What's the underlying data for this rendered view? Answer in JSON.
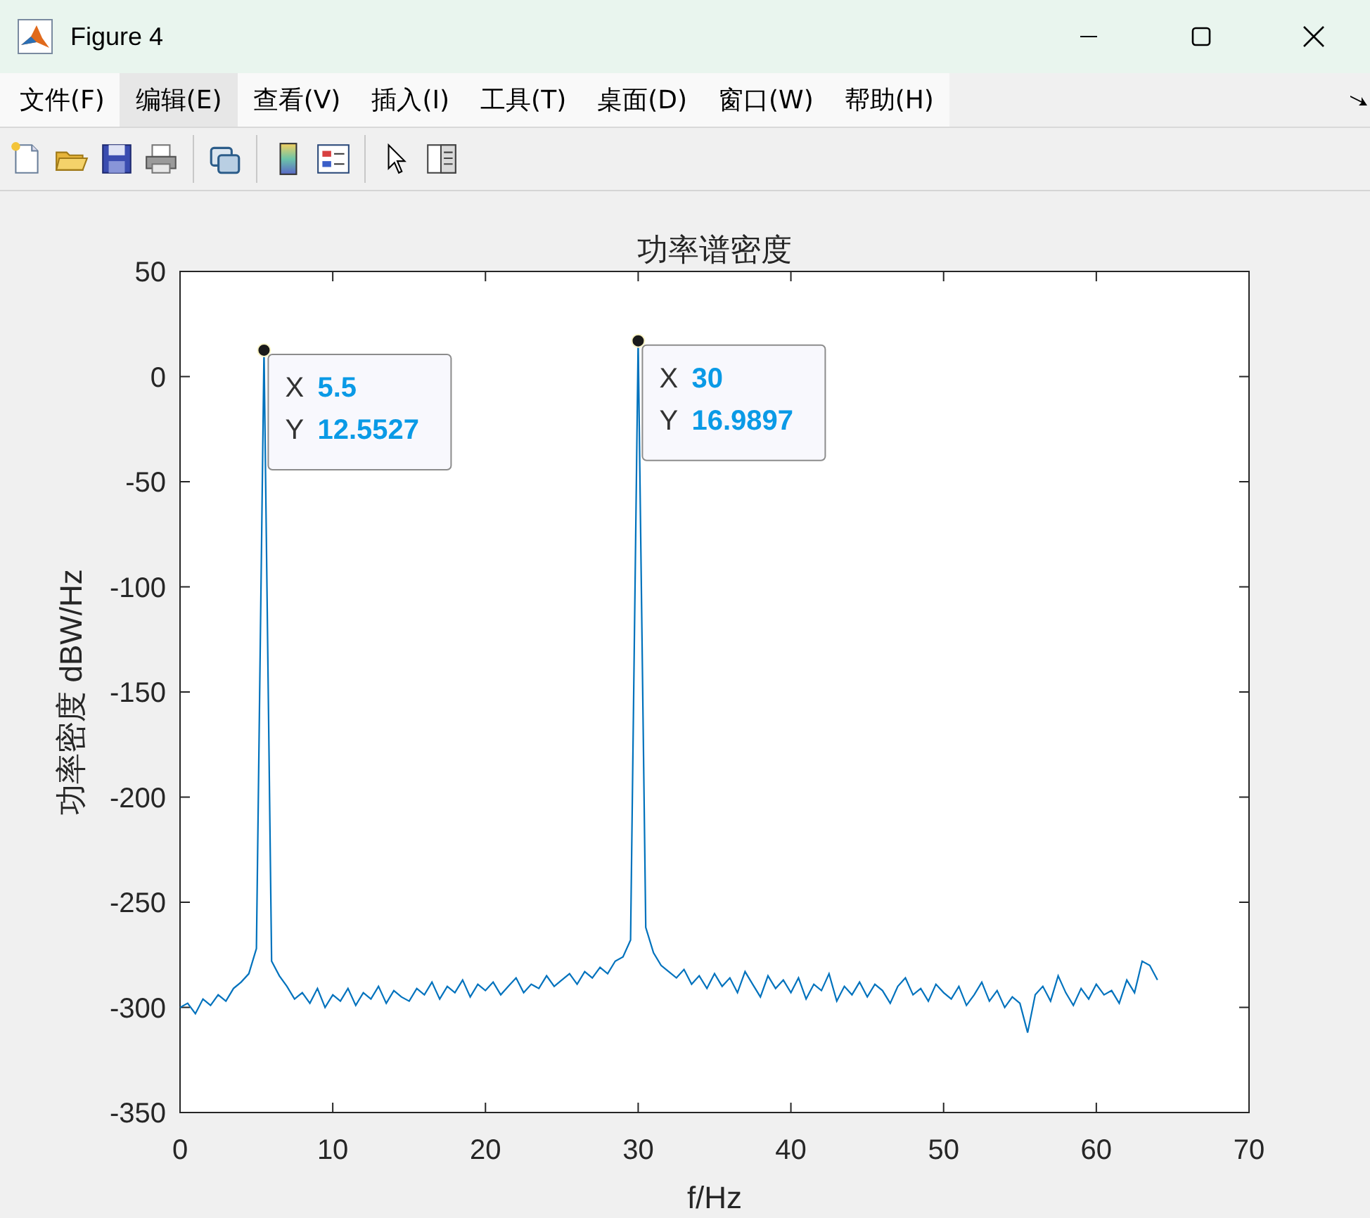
{
  "window": {
    "title": "Figure 4"
  },
  "menu": [
    {
      "label": "文件(F)",
      "selected": false
    },
    {
      "label": "编辑(E)",
      "selected": true
    },
    {
      "label": "查看(V)",
      "selected": false
    },
    {
      "label": "插入(I)",
      "selected": false
    },
    {
      "label": "工具(T)",
      "selected": false
    },
    {
      "label": "桌面(D)",
      "selected": false
    },
    {
      "label": "窗口(W)",
      "selected": false
    },
    {
      "label": "帮助(H)",
      "selected": false
    }
  ],
  "toolbar": [
    {
      "kind": "new"
    },
    {
      "kind": "open"
    },
    {
      "kind": "save"
    },
    {
      "kind": "print"
    },
    {
      "kind": "separator"
    },
    {
      "kind": "link"
    },
    {
      "kind": "separator"
    },
    {
      "kind": "colorbar"
    },
    {
      "kind": "legend"
    },
    {
      "kind": "separator"
    },
    {
      "kind": "pointer"
    },
    {
      "kind": "inspector"
    }
  ],
  "plot": {
    "chart_data": {
      "type": "line",
      "title": "功率谱密度",
      "xlabel": "f/Hz",
      "ylabel": "功率密度 dBW/Hz",
      "xlim": [
        0,
        70
      ],
      "ylim": [
        -350,
        50
      ],
      "xticks": [
        0,
        10,
        20,
        30,
        40,
        50,
        60,
        70
      ],
      "yticks": [
        -350,
        -300,
        -250,
        -200,
        -150,
        -100,
        -50,
        0,
        50
      ],
      "x": [
        0,
        0.5,
        1,
        1.5,
        2,
        2.5,
        3,
        3.5,
        4,
        4.5,
        5,
        5.5,
        6,
        6.5,
        7,
        7.5,
        8,
        8.5,
        9,
        9.5,
        10,
        10.5,
        11,
        11.5,
        12,
        12.5,
        13,
        13.5,
        14,
        14.5,
        15,
        15.5,
        16,
        16.5,
        17,
        17.5,
        18,
        18.5,
        19,
        19.5,
        20,
        20.5,
        21,
        21.5,
        22,
        22.5,
        23,
        23.5,
        24,
        24.5,
        25,
        25.5,
        26,
        26.5,
        27,
        27.5,
        28,
        28.5,
        29,
        29.5,
        30,
        30.5,
        31,
        31.5,
        32,
        32.5,
        33,
        33.5,
        34,
        34.5,
        35,
        35.5,
        36,
        36.5,
        37,
        37.5,
        38,
        38.5,
        39,
        39.5,
        40,
        40.5,
        41,
        41.5,
        42,
        42.5,
        43,
        43.5,
        44,
        44.5,
        45,
        45.5,
        46,
        46.5,
        47,
        47.5,
        48,
        48.5,
        49,
        49.5,
        50,
        50.5,
        51,
        51.5,
        52,
        52.5,
        53,
        53.5,
        54,
        54.5,
        55,
        55.5,
        56,
        56.5,
        57,
        57.5,
        58,
        58.5,
        59,
        59.5,
        60,
        60.5,
        61,
        61.5,
        62,
        62.5,
        63,
        63.5,
        64
      ],
      "series": [
        {
          "color": "#0072bd",
          "values": [
            -300,
            -298,
            -303,
            -296,
            -299,
            -294,
            -297,
            -291,
            -288,
            -284,
            -272,
            12.6,
            -278,
            -285,
            -290,
            -296,
            -293,
            -298,
            -291,
            -300,
            -294,
            -297,
            -291,
            -299,
            -293,
            -296,
            -290,
            -298,
            -292,
            -295,
            -297,
            -291,
            -294,
            -288,
            -296,
            -290,
            -293,
            -287,
            -295,
            -289,
            -292,
            -288,
            -294,
            -290,
            -286,
            -293,
            -289,
            -291,
            -285,
            -290,
            -287,
            -284,
            -289,
            -283,
            -286,
            -281,
            -284,
            -278,
            -276,
            -268,
            17,
            -262,
            -274,
            -280,
            -283,
            -286,
            -282,
            -289,
            -285,
            -291,
            -284,
            -290,
            -286,
            -293,
            -283,
            -289,
            -295,
            -285,
            -291,
            -287,
            -293,
            -286,
            -296,
            -289,
            -292,
            -284,
            -297,
            -290,
            -294,
            -288,
            -295,
            -289,
            -292,
            -298,
            -290,
            -286,
            -294,
            -291,
            -297,
            -289,
            -293,
            -296,
            -290,
            -299,
            -294,
            -288,
            -297,
            -292,
            -300,
            -295,
            -298,
            -312,
            -294,
            -290,
            -297,
            -285,
            -293,
            -299,
            -291,
            -296,
            -289,
            -294,
            -292,
            -298,
            -287,
            -293,
            -278,
            -280,
            -287
          ]
        }
      ]
    },
    "datatips": [
      {
        "x_label": "X",
        "x_value": "5.5",
        "y_label": "Y",
        "y_value": "12.5527"
      },
      {
        "x_label": "X",
        "x_value": "30",
        "y_label": "Y",
        "y_value": "16.9897"
      }
    ]
  }
}
